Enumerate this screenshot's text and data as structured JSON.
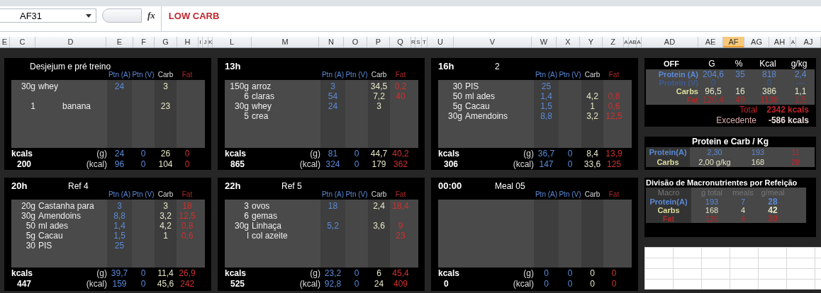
{
  "name_box": "AF31",
  "function_label": "fx",
  "formula": "LOW CARB",
  "columns": [
    {
      "label": "E",
      "selected": false
    },
    {
      "label": "C",
      "selected": false
    },
    {
      "label": "D",
      "selected": false
    },
    {
      "label": "E",
      "selected": false
    },
    {
      "label": "F",
      "selected": false
    },
    {
      "label": "G",
      "selected": false
    },
    {
      "label": "H",
      "selected": false
    },
    {
      "label": "I",
      "selected": false
    },
    {
      "label": "J",
      "selected": false
    },
    {
      "label": "K",
      "selected": false
    },
    {
      "label": "L",
      "selected": false
    },
    {
      "label": "M",
      "selected": false
    },
    {
      "label": "N",
      "selected": false
    },
    {
      "label": "O",
      "selected": false
    },
    {
      "label": "P",
      "selected": false
    },
    {
      "label": "Q",
      "selected": false
    },
    {
      "label": "R",
      "selected": false
    },
    {
      "label": "S",
      "selected": false
    },
    {
      "label": "T",
      "selected": false
    },
    {
      "label": "U",
      "selected": false
    },
    {
      "label": "V",
      "selected": false
    },
    {
      "label": "W",
      "selected": false
    },
    {
      "label": "X",
      "selected": false
    },
    {
      "label": "Y",
      "selected": false
    },
    {
      "label": "Z",
      "selected": false
    },
    {
      "label": "A",
      "selected": false
    },
    {
      "label": "AB",
      "selected": false
    },
    {
      "label": "A",
      "selected": false
    },
    {
      "label": "AD",
      "selected": false
    },
    {
      "label": "AE",
      "selected": false
    },
    {
      "label": "AF",
      "selected": true
    },
    {
      "label": "AG",
      "selected": false
    },
    {
      "label": "AH",
      "selected": false
    },
    {
      "label": "A",
      "selected": false
    },
    {
      "label": "AJ",
      "selected": false
    }
  ],
  "meals": [
    {
      "title": "Desjejum e pré treino",
      "headers": [
        "Ptn (A)",
        "Ptn (V)",
        "Carb",
        "Fat"
      ],
      "items": [
        {
          "qty": "30g",
          "food": "whey",
          "ptn_a": "24",
          "carb": "3",
          "spaced": false
        },
        {
          "qty": "1",
          "food": "banana",
          "carb": "23",
          "spaced": true
        }
      ],
      "totals": {
        "label": "kcals",
        "kcal": "200",
        "g_unit": "(g)",
        "g": [
          "24",
          "0",
          "26",
          "0"
        ],
        "kcal_unit": "(kcal)",
        "kcals": [
          "96",
          "0",
          "104",
          "0"
        ]
      }
    },
    {
      "time": "13h",
      "headers": [
        "Ptn (A)",
        "Ptn (V)",
        "Carb",
        "Fat"
      ],
      "items": [
        {
          "qty": "150g",
          "food": "arroz",
          "ptn_a": "3",
          "carb": "34,5",
          "fat": "0,2",
          "spaced": false
        },
        {
          "qty": "6",
          "food": "claras",
          "ptn_a": "54",
          "carb": "7,2",
          "fat": "40",
          "spaced": false
        },
        {
          "qty": "30g",
          "food": "whey",
          "ptn_a": "24",
          "carb": "3",
          "spaced": false
        },
        {
          "qty": "5",
          "food": "crea",
          "spaced": false
        }
      ],
      "totals": {
        "label": "kcals",
        "kcal": "865",
        "g_unit": "(g)",
        "g": [
          "81",
          "0",
          "44,7",
          "40,2"
        ],
        "kcal_unit": "(kcal)",
        "kcals": [
          "324",
          "0",
          "179",
          "362"
        ]
      }
    },
    {
      "time": "16h",
      "title": "2",
      "headers": [
        "Ptn (A)",
        "Ptn (V)",
        "Carb",
        "Fat"
      ],
      "items": [
        {
          "qty": "30",
          "food": "PIS",
          "ptn_a": "25",
          "spaced": false
        },
        {
          "qty": "50",
          "food": "ml ades",
          "ptn_a": "1,4",
          "carb": "4,2",
          "fat": "0,8",
          "spaced": false
        },
        {
          "qty": "5g",
          "food": "Cacau",
          "ptn_a": "1,5",
          "carb": "1",
          "fat": "0,6",
          "spaced": false
        },
        {
          "qty": "30g",
          "food": "Amendoins",
          "ptn_a": "8,8",
          "carb": "3,2",
          "fat": "12,5",
          "spaced": false
        }
      ],
      "totals": {
        "label": "kcals",
        "kcal": "306",
        "g_unit": "(g)",
        "g": [
          "36,7",
          "0",
          "8,4",
          "13,9"
        ],
        "kcal_unit": "(kcal)",
        "kcals": [
          "147",
          "0",
          "33,6",
          "125"
        ]
      }
    },
    {
      "time": "20h",
      "title": "Ref 4",
      "headers": [
        "Ptn (A)",
        "Ptn (V)",
        "Carb",
        "Fat"
      ],
      "items": [
        {
          "qty": "20g",
          "food": "Castanha para",
          "ptn_a": "3",
          "carb": "3",
          "fat": "18",
          "spaced": false
        },
        {
          "qty": "30g",
          "food": "Amendoins",
          "ptn_a": "8,8",
          "carb": "3,2",
          "fat": "12,5",
          "spaced": false
        },
        {
          "qty": "50",
          "food": "ml ades",
          "ptn_a": "1,4",
          "carb": "4,2",
          "fat": "0,8",
          "spaced": false
        },
        {
          "qty": "5g",
          "food": "Cacau",
          "ptn_a": "1,5",
          "carb": "1",
          "fat": "0,6",
          "spaced": false
        },
        {
          "qty": "30",
          "food": "PIS",
          "ptn_a": "25",
          "spaced": false
        }
      ],
      "totals": {
        "label": "kcals",
        "kcal": "447",
        "g_unit": "(g)",
        "g": [
          "39,7",
          "0",
          "11,4",
          "26,9"
        ],
        "kcal_unit": "(kcal)",
        "kcals": [
          "159",
          "0",
          "45,6",
          "242"
        ]
      }
    },
    {
      "time": "22h",
      "title": "Ref 5",
      "headers": [
        "Ptn (A)",
        "Ptn (V)",
        "Carb",
        "Fat"
      ],
      "items": [
        {
          "qty": "3",
          "food": "ovos",
          "ptn_a": "18",
          "carb": "2,4",
          "fat": "18,4",
          "spaced": false
        },
        {
          "qty": "6",
          "food": "gemas",
          "spaced": false
        },
        {
          "qty": "30g",
          "food": "Linhaça",
          "ptn_a": "5,2",
          "carb": "3,6",
          "fat": "9",
          "spaced": false
        },
        {
          "qty": "l",
          "food": "col azeite",
          "fat": "23",
          "spaced": false
        }
      ],
      "totals": {
        "label": "kcals",
        "kcal": "525",
        "g_unit": "(g)",
        "g": [
          "23,2",
          "0",
          "6",
          "45,4"
        ],
        "kcal_unit": "(kcal)",
        "kcals": [
          "92,8",
          "0",
          "24",
          "409"
        ]
      }
    },
    {
      "time": "00:00",
      "title": "Meal 05",
      "headers": [
        "Ptn (A)",
        "Ptn (V)",
        "Carb",
        "Fat"
      ],
      "totals": {
        "label": "kcals",
        "kcal": "0",
        "g_unit": "(g)",
        "g": [
          "0",
          "0",
          "0",
          "0"
        ],
        "kcal_unit": "(kcal)",
        "kcals": [
          "0",
          "0",
          "0",
          "0"
        ]
      }
    }
  ],
  "summary": {
    "header": [
      "OFF",
      "G",
      "%",
      "Kcal",
      "g/kg"
    ],
    "rows": [
      {
        "kind": "ptn_a",
        "cells": [
          "Protein (A)",
          "204,6",
          "35",
          "818",
          "2,4"
        ]
      },
      {
        "kind": "ptn_v",
        "cells": [
          "Protein (V)",
          "0",
          "-",
          "0",
          "—"
        ]
      },
      {
        "kind": "carbs",
        "cells": [
          "Carbs",
          "96,5",
          "16",
          "386",
          "1,1"
        ]
      },
      {
        "kind": "fat",
        "cells": [
          "Fat",
          "120,4",
          "49",
          "1138",
          "1,5"
        ]
      }
    ],
    "total_label": "Total",
    "total": "2342",
    "total_unit": "kcals",
    "surplus_label": "Excedente",
    "surplus": "-586",
    "surplus_unit": "kcals"
  },
  "per_kg": {
    "title": "Protein e Carb / Kg",
    "rows": [
      {
        "kind": "ptn_a",
        "cells": [
          "Protein(A)",
          "2,30",
          "193",
          "11"
        ]
      },
      {
        "kind": "carbs",
        "cells": [
          "Carbs",
          "2,00 g/kg",
          "168",
          "28"
        ]
      }
    ]
  },
  "division": {
    "title": "Divisão de Macronutrientes por Refeição",
    "header": [
      "Macro",
      "g total",
      "meals",
      "g/meal"
    ],
    "rows": [
      {
        "kind": "ptn_a",
        "cells": [
          "Protein(A)",
          "193",
          "7",
          "28"
        ]
      },
      {
        "kind": "carbs",
        "cells": [
          "Carbs",
          "168",
          "4",
          "42"
        ]
      },
      {
        "kind": "fat",
        "cells": [
          "Fat",
          "120",
          "4",
          "30"
        ]
      }
    ]
  }
}
